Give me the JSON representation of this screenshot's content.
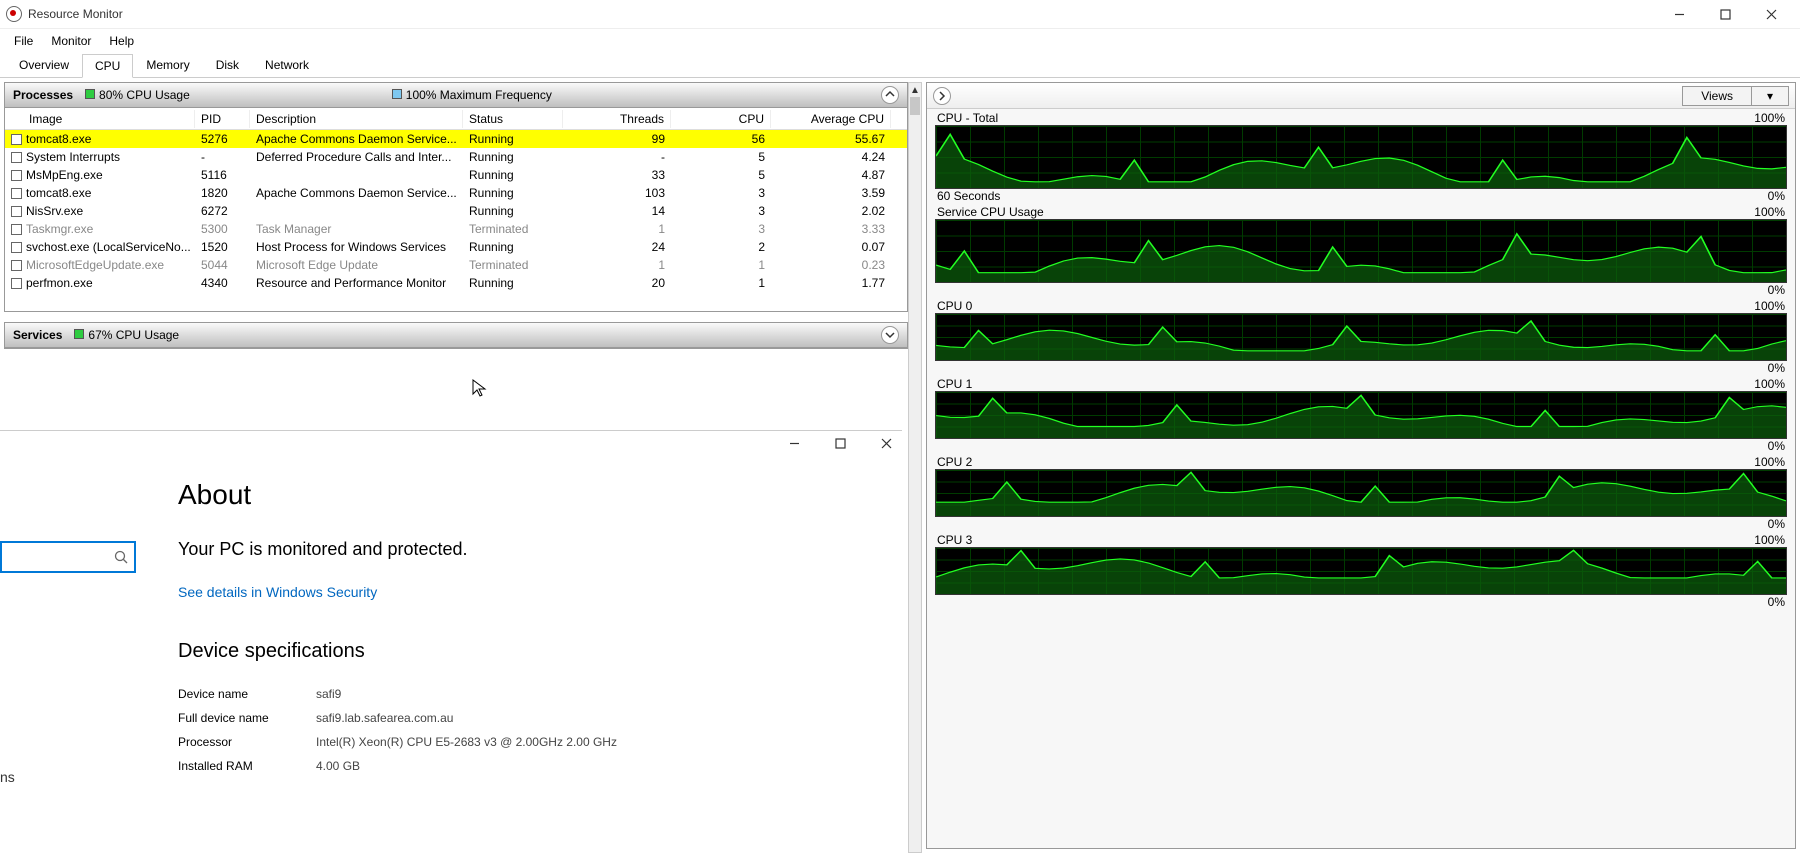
{
  "window": {
    "title": "Resource Monitor"
  },
  "win_controls": {
    "min": "—",
    "max": "☐",
    "close": "✕"
  },
  "menu": [
    "File",
    "Monitor",
    "Help"
  ],
  "tabs": {
    "items": [
      "Overview",
      "CPU",
      "Memory",
      "Disk",
      "Network"
    ],
    "active": 1
  },
  "processes_panel": {
    "title": "Processes",
    "metric1": "80% CPU Usage",
    "metric2": "100% Maximum Frequency"
  },
  "proc_cols": [
    "Image",
    "PID",
    "Description",
    "Status",
    "Threads",
    "CPU",
    "Average CPU"
  ],
  "proc_rows": [
    {
      "sel": true,
      "term": false,
      "image": "tomcat8.exe",
      "pid": "5276",
      "desc": "Apache Commons Daemon Service...",
      "status": "Running",
      "threads": "99",
      "cpu": "56",
      "avg": "55.67"
    },
    {
      "sel": false,
      "term": false,
      "image": "System Interrupts",
      "pid": "-",
      "desc": "Deferred Procedure Calls and Inter...",
      "status": "Running",
      "threads": "-",
      "cpu": "5",
      "avg": "4.24"
    },
    {
      "sel": false,
      "term": false,
      "image": "MsMpEng.exe",
      "pid": "5116",
      "desc": "",
      "status": "Running",
      "threads": "33",
      "cpu": "5",
      "avg": "4.87"
    },
    {
      "sel": false,
      "term": false,
      "image": "tomcat8.exe",
      "pid": "1820",
      "desc": "Apache Commons Daemon Service...",
      "status": "Running",
      "threads": "103",
      "cpu": "3",
      "avg": "3.59"
    },
    {
      "sel": false,
      "term": false,
      "image": "NisSrv.exe",
      "pid": "6272",
      "desc": "",
      "status": "Running",
      "threads": "14",
      "cpu": "3",
      "avg": "2.02"
    },
    {
      "sel": false,
      "term": true,
      "image": "Taskmgr.exe",
      "pid": "5300",
      "desc": "Task Manager",
      "status": "Terminated",
      "threads": "1",
      "cpu": "3",
      "avg": "3.33"
    },
    {
      "sel": false,
      "term": false,
      "image": "svchost.exe (LocalServiceNo...",
      "pid": "1520",
      "desc": "Host Process for Windows Services",
      "status": "Running",
      "threads": "24",
      "cpu": "2",
      "avg": "0.07"
    },
    {
      "sel": false,
      "term": true,
      "image": "MicrosoftEdgeUpdate.exe",
      "pid": "5044",
      "desc": "Microsoft Edge Update",
      "status": "Terminated",
      "threads": "1",
      "cpu": "1",
      "avg": "0.23"
    },
    {
      "sel": false,
      "term": false,
      "image": "perfmon.exe",
      "pid": "4340",
      "desc": "Resource and Performance Monitor",
      "status": "Running",
      "threads": "20",
      "cpu": "1",
      "avg": "1.77"
    }
  ],
  "services_panel": {
    "title": "Services",
    "metric1": "67% CPU Usage"
  },
  "right_panel": {
    "views_label": "Views",
    "graphs": [
      {
        "title": "CPU - Total",
        "top": "100%",
        "bottom_left": "60 Seconds",
        "bottom_right": "0%",
        "tall": true
      },
      {
        "title": "Service CPU Usage",
        "top": "100%",
        "bottom_left": "",
        "bottom_right": "0%",
        "tall": true
      },
      {
        "title": "CPU 0",
        "top": "100%",
        "bottom_left": "",
        "bottom_right": "0%",
        "tall": false
      },
      {
        "title": "CPU 1",
        "top": "100%",
        "bottom_left": "",
        "bottom_right": "0%",
        "tall": false
      },
      {
        "title": "CPU 2",
        "top": "100%",
        "bottom_left": "",
        "bottom_right": "0%",
        "tall": false
      },
      {
        "title": "CPU 3",
        "top": "100%",
        "bottom_left": "",
        "bottom_right": "0%",
        "tall": false
      }
    ]
  },
  "about": {
    "heading": "About",
    "subtitle": "Your PC is monitored and protected.",
    "link": "See details in Windows Security",
    "spec_heading": "Device specifications",
    "specs": [
      {
        "label": "Device name",
        "value": "safi9"
      },
      {
        "label": "Full device name",
        "value": "safi9.lab.safearea.com.au"
      },
      {
        "label": "Processor",
        "value": "Intel(R) Xeon(R) CPU E5-2683 v3 @ 2.00GHz   2.00 GHz"
      },
      {
        "label": "Installed RAM",
        "value": "4.00 GB"
      }
    ]
  },
  "sidebar_fragment": "ns"
}
